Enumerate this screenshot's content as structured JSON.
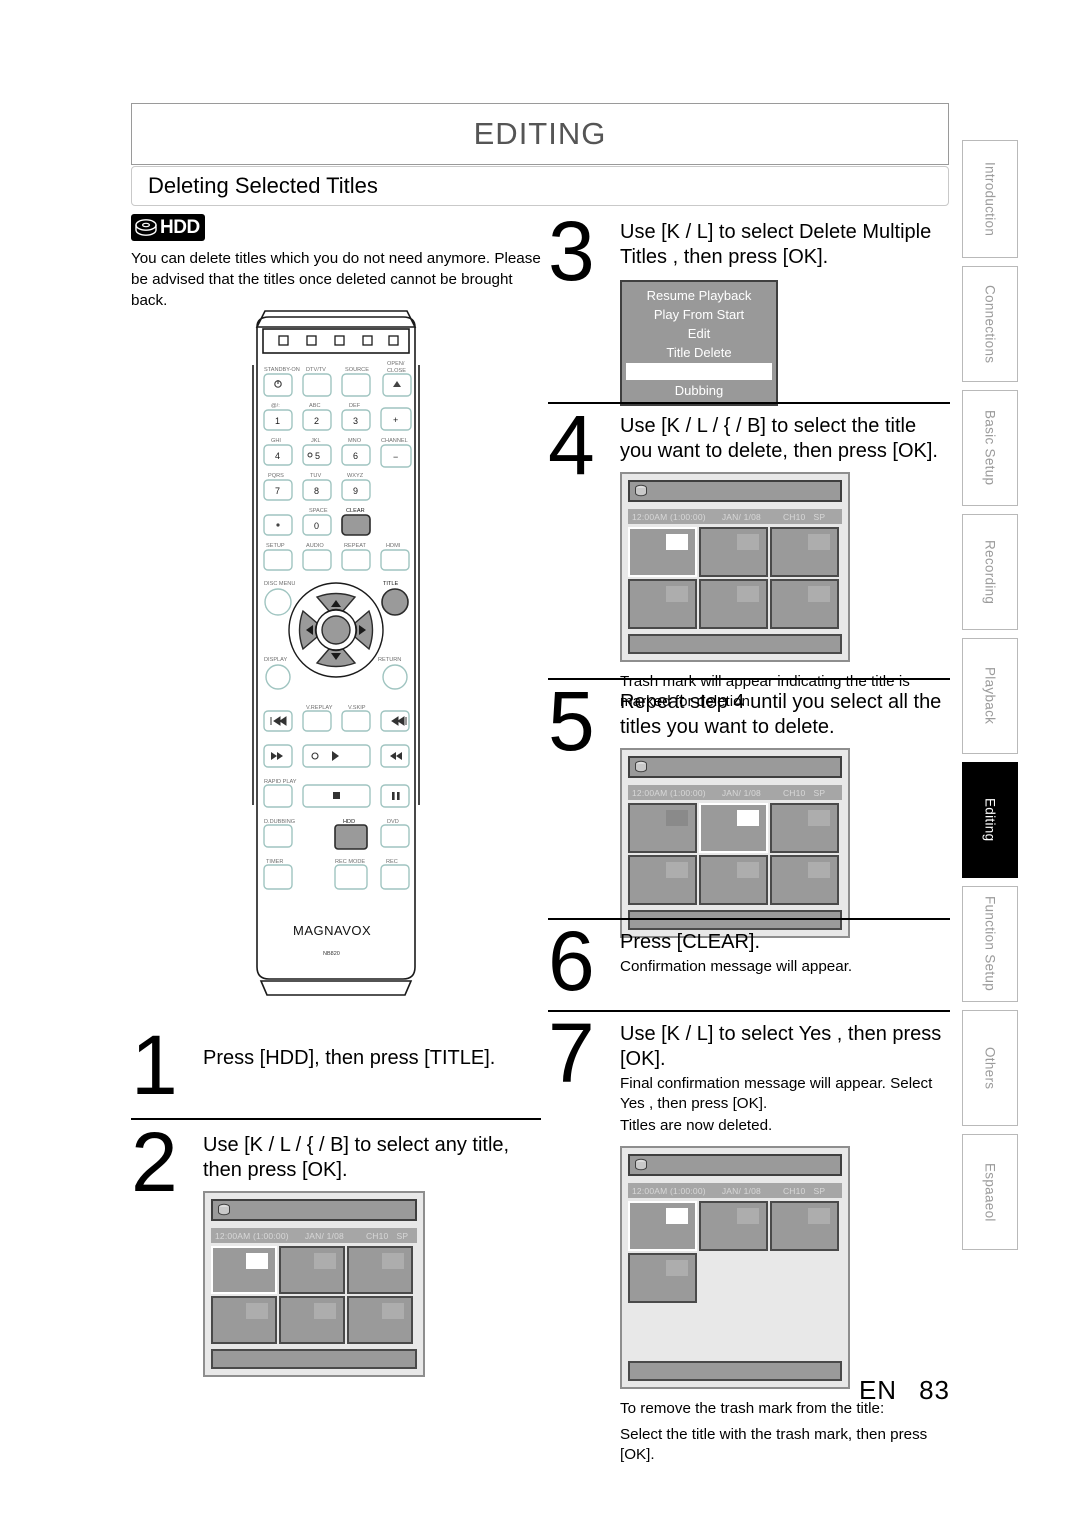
{
  "header": {
    "chapter": "EDITING",
    "section": "Deleting Selected Titles"
  },
  "badge": {
    "label": "HDD",
    "icon": "hdd-disc-icon"
  },
  "intro": "You can delete titles which you do not need anymore. Please be advised that the titles once deleted cannot be brought back.",
  "steps": {
    "s1": {
      "num": "1",
      "text": "Press [HDD], then press [TITLE]."
    },
    "s2": {
      "num": "2",
      "text": "Use [K / L / { / B] to select any title, then press [OK]."
    },
    "s3": {
      "num": "3",
      "text": "Use [K / L] to select  Delete Multiple Titles , then press [OK]."
    },
    "s4": {
      "num": "4",
      "text": "Use [K / L / { / B] to select the title you want to delete, then press [OK].",
      "note": "Trash mark will appear indicating the title is marked for deletion."
    },
    "s5": {
      "num": "5",
      "text": "Repeat step 4 until you select all the titles you want to delete."
    },
    "s6": {
      "num": "6",
      "text": "Press [CLEAR].",
      "note": "Confirmation message will appear."
    },
    "s7": {
      "num": "7",
      "text": "Use [K / L] to select  Yes , then press [OK].",
      "note1": "Final confirmation message will appear. Select  Yes , then press [OK].",
      "note2": "Titles are now deleted.",
      "note3": "To remove the trash mark from the title:",
      "note4": "Select the title with the trash mark, then press [OK]."
    }
  },
  "osd_menu": {
    "items": [
      "Resume Playback",
      "Play From Start",
      "Edit",
      "Title Delete"
    ],
    "highlighted": "",
    "last_item": "Dubbing"
  },
  "osd_info": {
    "time": "12:00AM (1:00:00)",
    "date": "JAN/ 1/08",
    "channel": "CH10",
    "mode": "SP"
  },
  "remote": {
    "brand": "MAGNAVOX",
    "model": "NB820",
    "buttons": {
      "standby": "STANDBY-ON",
      "dtvtv": "DTV/TV",
      "source": "SOURCE",
      "open_close_1": "OPEN/",
      "open_close_2": "CLOSE",
      "k1_sub": "@/:",
      "k1": "1",
      "k2_sub": "ABC",
      "k2": "2",
      "k3_sub": "DEF",
      "k3": "3",
      "k4_sub": "GHI",
      "k4": "4",
      "k5_sub": "JKL",
      "k5": "5",
      "k6_sub": "MNO",
      "k6": "6",
      "k7_sub": "PQRS",
      "k7": "7",
      "k8_sub": "TUV",
      "k8": "8",
      "k9_sub": "WXYZ",
      "k9": "9",
      "k0_sub": "SPACE",
      "k0": "0",
      "dot": "",
      "clear": "CLEAR",
      "channel": "CHANNEL",
      "ch_plus": "+",
      "ch_minus": "−",
      "setup": "SETUP",
      "audio": "AUDIO",
      "repeat": "REPEAT",
      "hdmi": "HDMI",
      "disc_menu": "DISC MENU",
      "title": "TITLE",
      "display": "DISPLAY",
      "return": "RETURN",
      "v_replay": "V.REPLAY",
      "v_skip": "V.SKIP",
      "rapid_play": "RAPID PLAY",
      "d_dubbing": "D.DUBBING",
      "hdd": "HDD",
      "dvd": "DVD",
      "timer": "TIMER",
      "rec_mode": "REC MODE",
      "rec": "REC"
    }
  },
  "sidebar": {
    "tabs": [
      {
        "label": "Introduction",
        "active": false
      },
      {
        "label": "Connections",
        "active": false
      },
      {
        "label": "Basic Setup",
        "active": false
      },
      {
        "label": "Recording",
        "active": false
      },
      {
        "label": "Playback",
        "active": false
      },
      {
        "label": "Editing",
        "active": true
      },
      {
        "label": "Function Setup",
        "active": false
      },
      {
        "label": "Others",
        "active": false
      },
      {
        "label": "Espaaeol",
        "active": false
      }
    ]
  },
  "footer": {
    "lang": "EN",
    "page": "83"
  }
}
